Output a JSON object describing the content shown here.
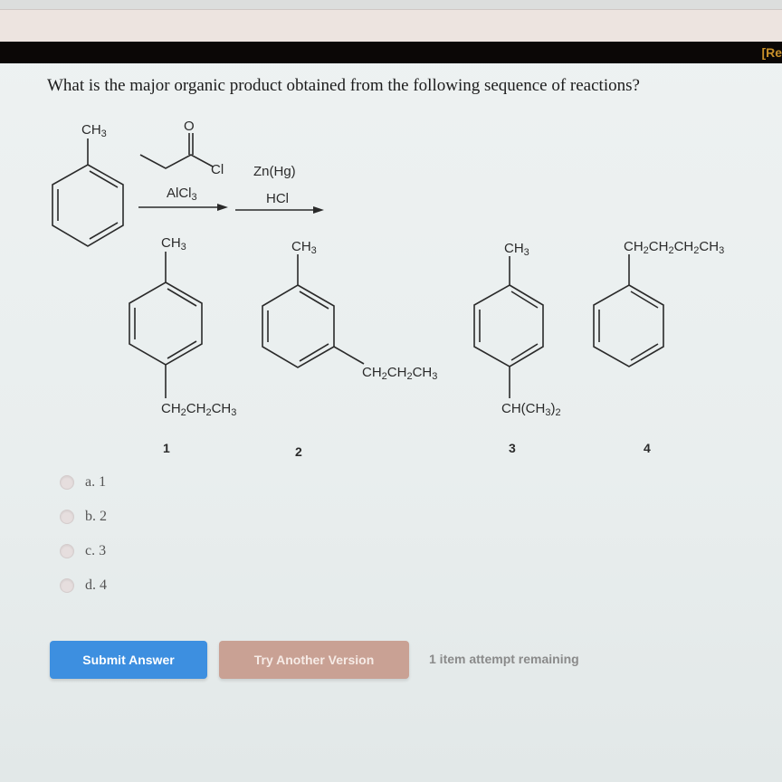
{
  "header": {
    "corner_label": "[Re"
  },
  "question": {
    "text": "What is the major organic product obtained from the following sequence of reactions?"
  },
  "reaction": {
    "starting_material": {
      "substituent": "CH3",
      "name": "toluene"
    },
    "step1": {
      "reagent_top": "propanoyl chloride",
      "reagent_atom": "O",
      "leaving_group": "Cl",
      "catalyst": "AlCl3"
    },
    "step2": {
      "reagent_top": "Zn(Hg)",
      "reagent_bottom": "HCl"
    }
  },
  "products": [
    {
      "number": "1",
      "top": "CH3",
      "bottom": "CH2CH2CH3",
      "pattern": "para"
    },
    {
      "number": "2",
      "top": "CH3",
      "side": "CH2CH2CH3",
      "pattern": "meta"
    },
    {
      "number": "3",
      "top": "CH3",
      "bottom": "CH(CH3)2",
      "pattern": "para"
    },
    {
      "number": "4",
      "top": "CH2CH2CH2CH3",
      "pattern": "mono"
    }
  ],
  "choices": [
    {
      "label": "a. 1",
      "selected": false
    },
    {
      "label": "b. 2",
      "selected": false
    },
    {
      "label": "c. 3",
      "selected": false
    },
    {
      "label": "d. 4",
      "selected": false
    }
  ],
  "actions": {
    "submit_label": "Submit Answer",
    "try_label": "Try Another Version",
    "attempts_text": "1 item attempt remaining"
  },
  "colors": {
    "submit": "#3d8fe0",
    "try_another": "#c9a194",
    "header_black": "#0b0706"
  }
}
